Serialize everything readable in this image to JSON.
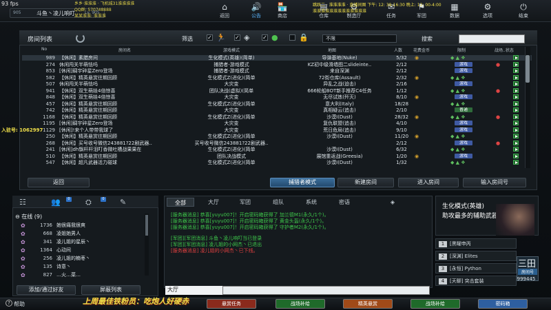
{
  "fps": "93 fps",
  "overlay": {
    "notice_lines": [
      "乡乡·淮淮淮 · 飞机城31淮淮淮淮",
      "QQ群: 570748888",
      "某某淮淮: 淮淮淮"
    ],
    "ticker_lines": [
      "跳跃二 · 淮淮淮淮 · 直播间图  下午: 12: 39-16:30  晚上: 12: 00-4:00",
      "淮淮淮淮淮淮淮淮淮淮淮淮淮"
    ],
    "left_marker": "入驻号: 1062997",
    "promo": "上周最佳铁粉员：吃炮人好硬赤"
  },
  "player": {
    "id": "905",
    "name": "斗鱼丶凌儿响叮",
    "level": "Lv. 905"
  },
  "nav": [
    {
      "label": "返回",
      "icon": "⌂"
    },
    {
      "label": "公告",
      "icon": "🔊"
    },
    {
      "label": "商店",
      "icon": "🏪"
    },
    {
      "label": "仓库",
      "icon": "▤"
    },
    {
      "label": "制造厅",
      "icon": "⚙"
    },
    {
      "label": "任务",
      "icon": "✉"
    },
    {
      "label": "军团",
      "icon": "⚑"
    },
    {
      "label": "数据",
      "icon": "▦"
    },
    {
      "label": "选项",
      "icon": "⚙"
    },
    {
      "label": "结束",
      "icon": "⏻"
    }
  ],
  "room_list": {
    "title": "房间列表",
    "filter_label": "筛选",
    "mode_select": "不限",
    "search_label": "搜索",
    "headers": {
      "no": "No",
      "name": "房间名",
      "mode": "游戏模式",
      "map": "地图",
      "count": "人数",
      "cost": "花费金币",
      "weapon": "限制",
      "rank": "战场..状态"
    },
    "rows": [
      {
        "no": "989",
        "name": "【休闲】素腊房间",
        "mode": "生化模式(英雄)(简单)",
        "map": "导弹基地(Nuke)",
        "count": "5/32",
        "badge": ""
      },
      {
        "no": "274",
        "name": "休闲闯关半萌怯吗",
        "mode": "捕猎者-游戏模式",
        "map": "KZ初中级滑墙图二slideinte..",
        "count": "2/12",
        "badge": "游戏"
      },
      {
        "no": "853",
        "name": "[休闲]碉宇碎星Zero登场",
        "mode": "捕猎者-游戏模式",
        "map": "来自深渊",
        "count": "2/12",
        "badge": "游戏"
      },
      {
        "no": "582",
        "name": "【休闲】精英悬赏往期回顾",
        "mode": "生化模式Z(进化)(简单",
        "map": "72街仓库(Assault)",
        "count": "2/32",
        "badge": ""
      },
      {
        "no": "507",
        "name": "休闲闯关半萌怯吗",
        "mode": "大灾变",
        "map": "异乱之战(迫击)",
        "count": "2/16",
        "badge": "游戏"
      },
      {
        "no": "941",
        "name": "【休闲】双生萌娃4倍惊喜",
        "mode": "团队决战(虚拟)(简单",
        "map": "666轮船BOT新手推荐C4任务",
        "count": "1/12",
        "badge": ""
      },
      {
        "no": "848",
        "name": "【休闲】双生萌娃4倍惊喜",
        "mode": "大灾变",
        "map": "无尽试炼(歼灭)",
        "count": "8/10",
        "badge": "游戏"
      },
      {
        "no": "457",
        "name": "【休闲】精英悬赏往期回顾",
        "mode": "生化模式Z(进化)(简单",
        "map": "意大利(Italy)",
        "count": "18/28",
        "badge": ""
      },
      {
        "no": "742",
        "name": "【休闲】精英悬赏往期回顾",
        "mode": "大灾变",
        "map": "真相疑云(追击)",
        "count": "2/10",
        "badge": "普通"
      },
      {
        "no": "1168",
        "name": "【休闲】精英悬赏往期回顾",
        "mode": "生化模式Z(进化)(简单",
        "map": "沙漠Ⅰ(Dust)",
        "count": "28/32",
        "badge": ""
      },
      {
        "no": "1195",
        "name": "[休闲]碉宇碎星Zero登场",
        "mode": "大灾变",
        "map": "复仇联盟(追击)",
        "count": "4/10",
        "badge": "游戏"
      },
      {
        "no": "1129",
        "name": "[休闲]!来个人带带我球了",
        "mode": "大灾变",
        "map": "荒日危局(追击)",
        "count": "9/10",
        "badge": "游戏"
      },
      {
        "no": "250",
        "name": "【休闲】精英悬赏往期回顾",
        "mode": "生化模式Z(进化)(简单",
        "map": "沙漠Ⅰ(Dust)",
        "count": "11/20",
        "badge": ""
      },
      {
        "no": "268",
        "name": "【休闲】买号收号微信243881?22剧武器..",
        "mode": "买号收号微信243881?22剧武器..",
        "map": "",
        "count": "2/12",
        "badge": "游戏"
      },
      {
        "no": "241",
        "name": "[休闲]dh飘杆杆泪叮香微吐槽战果果在",
        "mode": "生化模式Z(进化)(简单",
        "map": "沙漠Ⅰ(Dust)",
        "count": "6/32",
        "badge": ""
      },
      {
        "no": "510",
        "name": "【休闲】精英悬赏往期回顾",
        "mode": "团队决战模式",
        "map": "展馆重返战(Greesia)",
        "count": "1/20",
        "badge": "游戏"
      },
      {
        "no": "547",
        "name": "【休闲】超凡武器活力碰球",
        "mode": "生化模式Z(进化)(简单",
        "map": "沙漠Ⅰ(Dust)",
        "count": "1/32",
        "badge": ""
      }
    ],
    "buttons": {
      "back": "返回",
      "hunter_mode": "捕猎者模式",
      "new_room": "新建房间",
      "enter_room": "进入房间",
      "enter_room_no": "输入房间号"
    }
  },
  "friends": {
    "tab_badges": [
      "0",
      "0"
    ],
    "online_label": "在线 (9)",
    "list": [
      {
        "num": "1736",
        "name": "她很痛我很爽"
      },
      {
        "num": "668",
        "name": "凌姐她男人"
      },
      {
        "num": "341",
        "name": "凌儿姐的星辰丶"
      },
      {
        "num": "1364",
        "name": "心动间"
      },
      {
        "num": "256",
        "name": "凌儿姐的楠枣丶"
      },
      {
        "num": "135",
        "name": "诗意丶"
      },
      {
        "num": "827",
        "name": "…火…菜…"
      }
    ],
    "add_button": "添加/通过好友",
    "block_button": "屏蔽列表"
  },
  "chat": {
    "tabs": [
      "全部",
      "大厅",
      "军团",
      "组队",
      "系统",
      "密语",
      "◈"
    ],
    "messages": [
      {
        "text": "[服务器消息] 恭喜[yuyu007]！开启密码箱获得了 加兰德M1(永久/1个)。",
        "type": "sys"
      },
      {
        "text": "[服务器消息] 恭喜[yuyu007]！开启密码箱获得了 黄金头盔(永久/1个)。",
        "type": "sys"
      },
      {
        "text": "[服务器消息] 恭喜[yuyu007]！开启密码箱获得了 守护者M2(永久/1个)。",
        "type": "sys"
      },
      {
        "text": "[军团][军团消息] 斗鱼丶凌儿响叮当已登录",
        "type": "sys"
      },
      {
        "text": "[军团][军团消息] 凌儿姐的小网杰丶已退出",
        "type": "sys"
      },
      {
        "text": "[服务器消息] 凌儿姐的小网杰丶已下线。",
        "type": "team"
      }
    ],
    "channel": "大厅"
  },
  "mode_panel": {
    "title": "生化模式(英雄)",
    "subtitle": "助攻最多的辅助武器",
    "list": [
      {
        "num": "1",
        "name": "[黑曜申丙"
      },
      {
        "num": "2",
        "name": "[深渊] Elites"
      },
      {
        "num": "3",
        "name": "[永恒] Python"
      },
      {
        "num": "4",
        "name": "[天聊] 突击套装"
      }
    ],
    "room_no_label": "房间号",
    "room_no_value": "999445",
    "logo_text": "三田"
  },
  "bottom": {
    "help": "帮助",
    "buttons": [
      "悬赏任务",
      "战场补给",
      "精英悬赏",
      "战场补给",
      "密码箱"
    ],
    "button_colors": [
      "#8a2a1c",
      "#1f6a2a",
      "#a04a18",
      "#1f6a2a",
      "#2e5fa0"
    ]
  }
}
